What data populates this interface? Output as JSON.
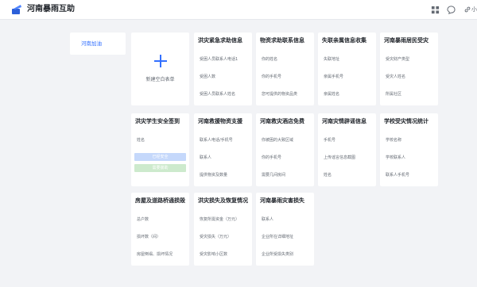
{
  "app": {
    "title": "河南暴雨互助",
    "brand_color": "#3370ff"
  },
  "header": {
    "more_label": "小"
  },
  "sidebar": {
    "items": [
      {
        "label": "河南加油"
      }
    ]
  },
  "new_form": {
    "label": "新建空白表单"
  },
  "cards": [
    {
      "title": "洪灾紧急求助信息",
      "fields": [
        "受困人员联系人电话1",
        "受困人数",
        "受困人员联系人姓名"
      ]
    },
    {
      "title": "物资求助联系信息",
      "fields": [
        "你的姓名",
        "你的手机号",
        "您可提供的物资品类"
      ]
    },
    {
      "title": "失联亲属信息收集",
      "fields": [
        "失联地址",
        "亲属手机号",
        "亲属姓名"
      ]
    },
    {
      "title": "河南暴雨居民受灾",
      "fields": [
        "受灾财产类型",
        "受灾人姓名",
        "所属社区"
      ]
    },
    {
      "title": "洪灾学生安全签到",
      "fields": [
        "姓名"
      ],
      "pills": [
        "已经安全",
        "需要援助"
      ]
    },
    {
      "title": "河南救援物资支援",
      "fields": [
        "联系人电话/手机号",
        "联系人",
        "提供物资及数量"
      ]
    },
    {
      "title": "河南救灾酒店免费",
      "fields": [
        "你被困的大致区域",
        "你的手机号",
        "需要几间房间"
      ]
    },
    {
      "title": "河南灾情辟谣信息",
      "fields": [
        "手机号",
        "上传谣言信息截图",
        "姓名"
      ]
    },
    {
      "title": "学校受灾情况统计",
      "fields": [
        "学校名称",
        "学校联系人",
        "联系人手机号"
      ]
    },
    {
      "title": "房屋及道路桥通损毁",
      "fields": [
        "总户数",
        "损坏数（间）",
        "房屋倒塌、损坏情况"
      ]
    },
    {
      "title": "洪灾损失及恢复情况",
      "fields": [
        "恢复所需资金（万元）",
        "受灾损失（万元）",
        "受灾影响小区数"
      ]
    },
    {
      "title": "河南暴雨灾害损失",
      "fields": [
        "联系人",
        "企业所在详细地址",
        "企业所受损失类别"
      ]
    }
  ]
}
